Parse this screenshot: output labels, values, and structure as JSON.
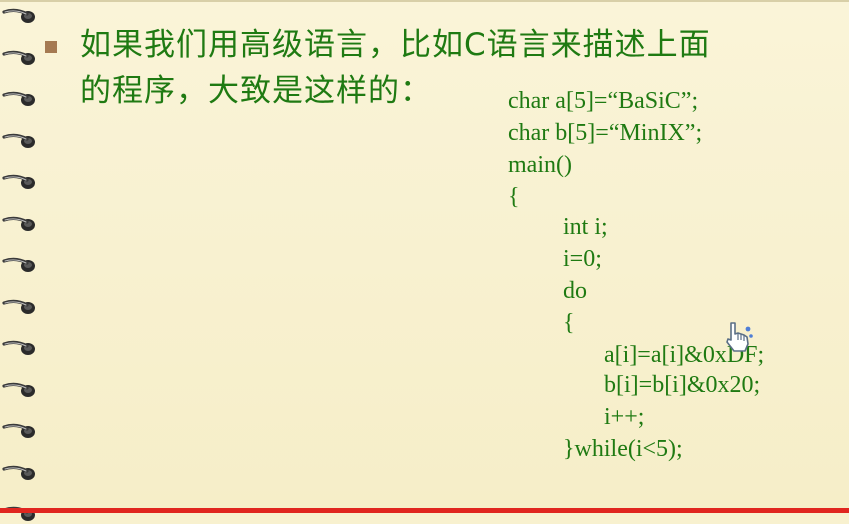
{
  "slide": {
    "heading_line1": "如果我们用高级语言，比如C语言来描述上面",
    "heading_line2": "的程序，大致是这样的：",
    "code_lines": [
      "char a[5]=“BaSiC”;",
      "char b[5]=“MinIX”;",
      "main()",
      "{",
      "int i;",
      "i=0;",
      "do",
      "{",
      "a[i]=a[i]&0xDF;",
      "b[i]=b[i]&0x20;",
      "i++;",
      "}while(i<5);"
    ]
  },
  "colors": {
    "text": "#1f7a12",
    "background": "#f8f1cf",
    "bullet": "#a57a52",
    "bottom_rule": "#e0261f"
  },
  "icons": {
    "binding": "spiral-ring-icon",
    "bullet": "square-bullet-icon",
    "cursor": "hand-pointer-cursor-icon"
  }
}
